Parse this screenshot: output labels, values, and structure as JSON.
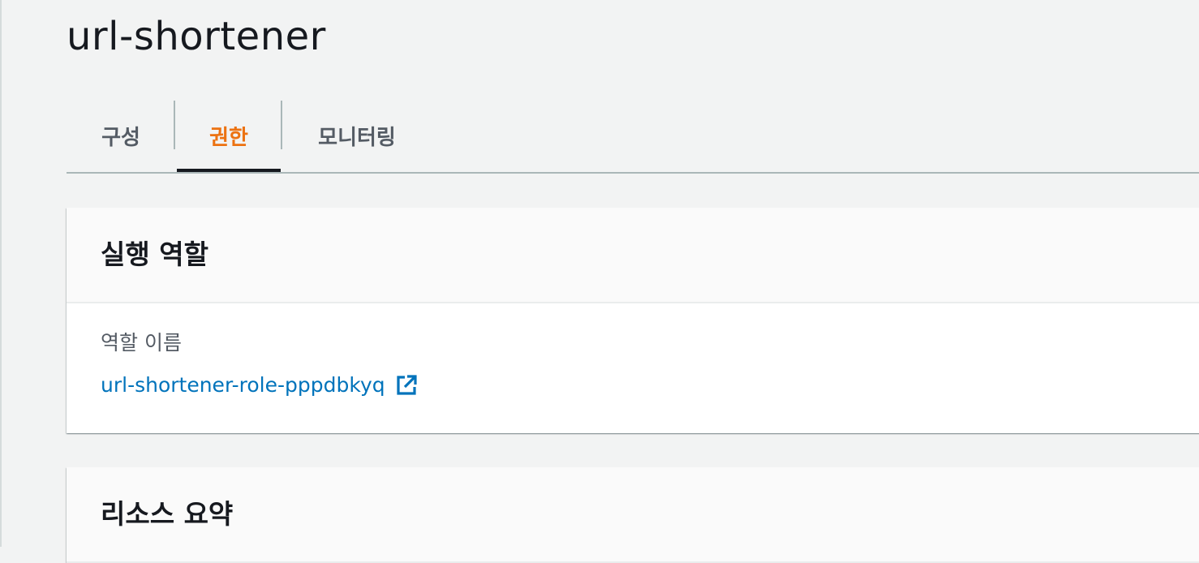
{
  "page": {
    "title": "url-shortener"
  },
  "tabs": [
    {
      "label": "구성",
      "active": false
    },
    {
      "label": "권한",
      "active": true
    },
    {
      "label": "모니터링",
      "active": false
    }
  ],
  "execution_role": {
    "title": "실행 역할",
    "role_name_label": "역할 이름",
    "role_name": "url-shortener-role-pppdbkyq",
    "link_icon": "external-link-icon"
  },
  "resource_summary": {
    "title": "리소스 요약"
  },
  "colors": {
    "active_tab": "#ec7211",
    "link": "#0073bb",
    "background": "#f2f3f3"
  }
}
